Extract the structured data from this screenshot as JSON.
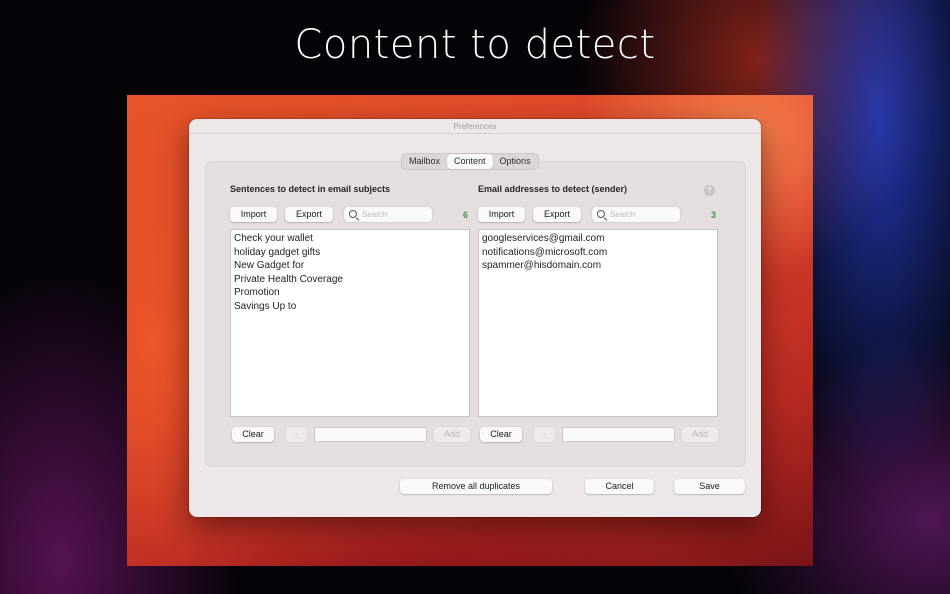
{
  "headline": "Content to detect",
  "window": {
    "title": "Preferences",
    "tabs": [
      "Mailbox",
      "Content",
      "Options"
    ],
    "active_tab": "Content"
  },
  "subjects": {
    "title": "Sentences to detect in email subjects",
    "import_label": "Import",
    "export_label": "Export",
    "search_placeholder": "Search",
    "count": "6",
    "items": [
      "Check your wallet",
      "holiday gadget gifts",
      "New Gadget for",
      "Private Health Coverage",
      "Promotion",
      "Savings Up to"
    ],
    "clear_label": "Clear",
    "remove_label": "-",
    "add_label": "Add",
    "new_value": ""
  },
  "senders": {
    "title": "Email addresses to detect (sender)",
    "help_icon": "?",
    "import_label": "Import",
    "export_label": "Export",
    "search_placeholder": "Search",
    "count": "3",
    "items": [
      "googleservices@gmail.com",
      "notifications@microsoft.com",
      "spammer@hisdomain.com"
    ],
    "clear_label": "Clear",
    "remove_label": "-",
    "add_label": "Add",
    "new_value": ""
  },
  "footer": {
    "remove_duplicates_label": "Remove all duplicates",
    "cancel_label": "Cancel",
    "save_label": "Save"
  },
  "colors": {
    "count_green": "#3f9a3f",
    "window_bg": "#ede7e7",
    "wallpaper_red": "#d9402a"
  }
}
